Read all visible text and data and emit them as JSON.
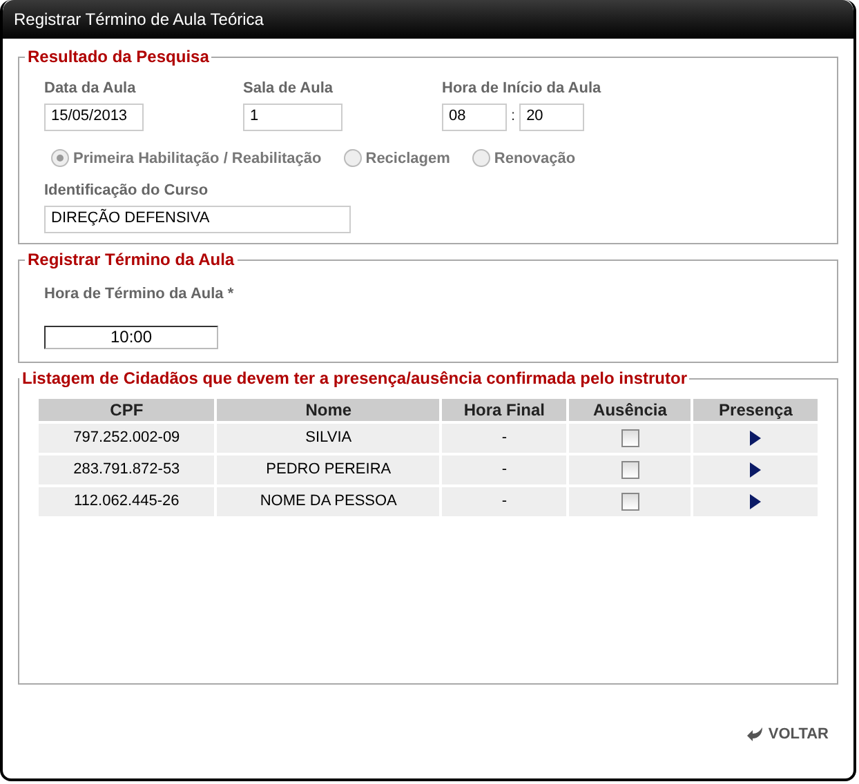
{
  "window": {
    "title": "Registrar Término de Aula Teórica"
  },
  "search_result": {
    "legend": "Resultado da Pesquisa",
    "date": {
      "label": "Data da Aula",
      "value": "15/05/2013"
    },
    "room": {
      "label": "Sala de Aula",
      "value": "1"
    },
    "start_time": {
      "label": "Hora de Início da Aula",
      "hour": "08",
      "separator": ":",
      "minute": "20"
    },
    "course_types": [
      {
        "label": "Primeira Habilitação / Reabilitação",
        "selected": true,
        "disabled": true
      },
      {
        "label": "Reciclagem",
        "selected": false,
        "disabled": true
      },
      {
        "label": "Renovação",
        "selected": false,
        "disabled": true
      }
    ],
    "course": {
      "label": "Identificação do Curso",
      "value": "DIREÇÃO DEFENSIVA"
    }
  },
  "end_section": {
    "legend": "Registrar Término da Aula",
    "label": "Hora de Término da Aula *",
    "value": "10:00"
  },
  "listing": {
    "legend": "Listagem de Cidadãos que devem ter a presença/ausência confirmada pelo instrutor",
    "columns": [
      "CPF",
      "Nome",
      "Hora Final",
      "Ausência",
      "Presença"
    ],
    "rows": [
      {
        "cpf": "797.252.002-09",
        "name": "SILVIA",
        "end_time": "-",
        "absent": false
      },
      {
        "cpf": "283.791.872-53",
        "name": "PEDRO PEREIRA",
        "end_time": "-",
        "absent": false
      },
      {
        "cpf": "112.062.445-26",
        "name": "NOME DA PESSOA",
        "end_time": "-",
        "absent": false
      }
    ]
  },
  "back_button": "VOLTAR"
}
